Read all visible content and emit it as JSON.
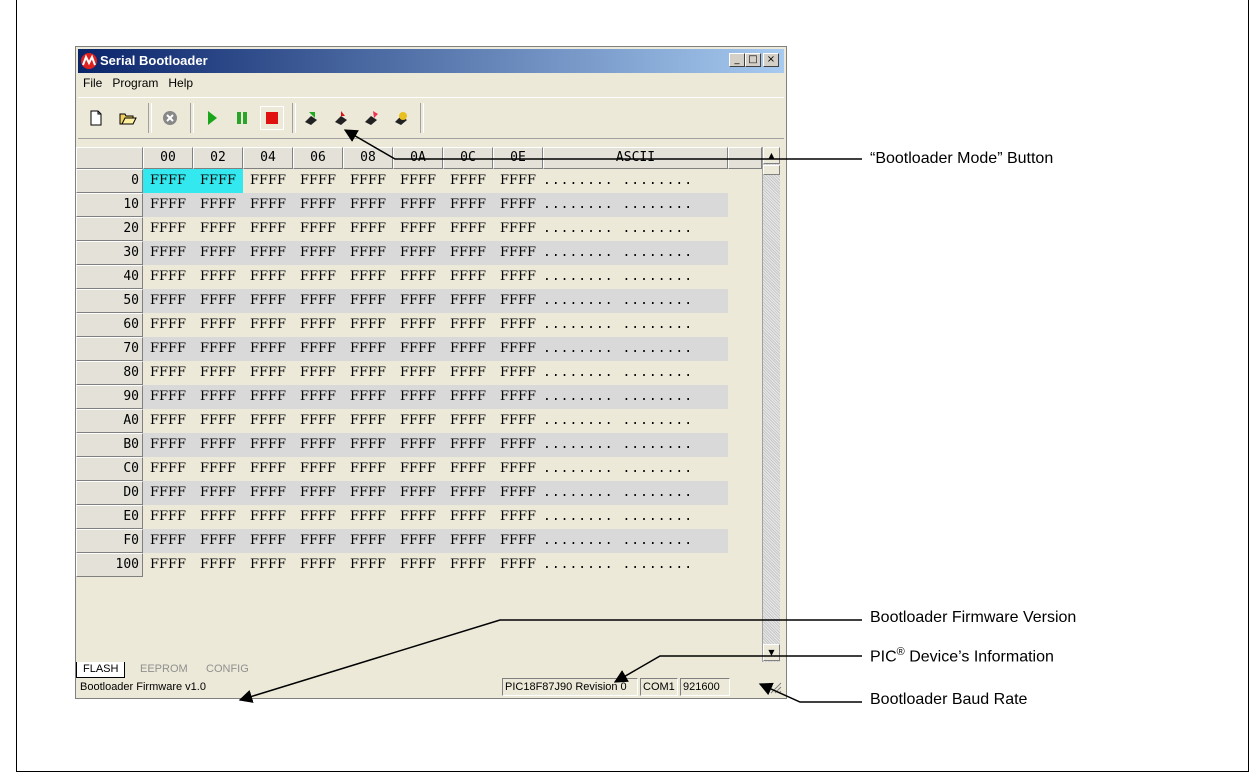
{
  "window": {
    "title": "Serial Bootloader",
    "controls": {
      "minimize": "_",
      "maximize": "□",
      "close": "×"
    }
  },
  "menu": {
    "items": [
      "File",
      "Program",
      "Help"
    ]
  },
  "toolbar": {
    "buttons": [
      "new-icon",
      "open-icon",
      "abort-icon",
      "run-icon",
      "pause-icon",
      "bootloader-mode-icon",
      "write-icon",
      "read-icon",
      "erase-icon",
      "verify-icon"
    ],
    "colors": {
      "run": "#1aa51a",
      "pause": "#2aa52a",
      "stop": "#e01010"
    }
  },
  "grid": {
    "columns": [
      "00",
      "02",
      "04",
      "06",
      "08",
      "0A",
      "0C",
      "0E",
      "ASCII"
    ],
    "rows": [
      {
        "addr": "0",
        "values": [
          "FFFF",
          "FFFF",
          "FFFF",
          "FFFF",
          "FFFF",
          "FFFF",
          "FFFF",
          "FFFF"
        ],
        "ascii": "........ ........"
      },
      {
        "addr": "10",
        "values": [
          "FFFF",
          "FFFF",
          "FFFF",
          "FFFF",
          "FFFF",
          "FFFF",
          "FFFF",
          "FFFF"
        ],
        "ascii": "........ ........"
      },
      {
        "addr": "20",
        "values": [
          "FFFF",
          "FFFF",
          "FFFF",
          "FFFF",
          "FFFF",
          "FFFF",
          "FFFF",
          "FFFF"
        ],
        "ascii": "........ ........"
      },
      {
        "addr": "30",
        "values": [
          "FFFF",
          "FFFF",
          "FFFF",
          "FFFF",
          "FFFF",
          "FFFF",
          "FFFF",
          "FFFF"
        ],
        "ascii": "........ ........"
      },
      {
        "addr": "40",
        "values": [
          "FFFF",
          "FFFF",
          "FFFF",
          "FFFF",
          "FFFF",
          "FFFF",
          "FFFF",
          "FFFF"
        ],
        "ascii": "........ ........"
      },
      {
        "addr": "50",
        "values": [
          "FFFF",
          "FFFF",
          "FFFF",
          "FFFF",
          "FFFF",
          "FFFF",
          "FFFF",
          "FFFF"
        ],
        "ascii": "........ ........"
      },
      {
        "addr": "60",
        "values": [
          "FFFF",
          "FFFF",
          "FFFF",
          "FFFF",
          "FFFF",
          "FFFF",
          "FFFF",
          "FFFF"
        ],
        "ascii": "........ ........"
      },
      {
        "addr": "70",
        "values": [
          "FFFF",
          "FFFF",
          "FFFF",
          "FFFF",
          "FFFF",
          "FFFF",
          "FFFF",
          "FFFF"
        ],
        "ascii": "........ ........"
      },
      {
        "addr": "80",
        "values": [
          "FFFF",
          "FFFF",
          "FFFF",
          "FFFF",
          "FFFF",
          "FFFF",
          "FFFF",
          "FFFF"
        ],
        "ascii": "........ ........"
      },
      {
        "addr": "90",
        "values": [
          "FFFF",
          "FFFF",
          "FFFF",
          "FFFF",
          "FFFF",
          "FFFF",
          "FFFF",
          "FFFF"
        ],
        "ascii": "........ ........"
      },
      {
        "addr": "A0",
        "values": [
          "FFFF",
          "FFFF",
          "FFFF",
          "FFFF",
          "FFFF",
          "FFFF",
          "FFFF",
          "FFFF"
        ],
        "ascii": "........ ........"
      },
      {
        "addr": "B0",
        "values": [
          "FFFF",
          "FFFF",
          "FFFF",
          "FFFF",
          "FFFF",
          "FFFF",
          "FFFF",
          "FFFF"
        ],
        "ascii": "........ ........"
      },
      {
        "addr": "C0",
        "values": [
          "FFFF",
          "FFFF",
          "FFFF",
          "FFFF",
          "FFFF",
          "FFFF",
          "FFFF",
          "FFFF"
        ],
        "ascii": "........ ........"
      },
      {
        "addr": "D0",
        "values": [
          "FFFF",
          "FFFF",
          "FFFF",
          "FFFF",
          "FFFF",
          "FFFF",
          "FFFF",
          "FFFF"
        ],
        "ascii": "........ ........"
      },
      {
        "addr": "E0",
        "values": [
          "FFFF",
          "FFFF",
          "FFFF",
          "FFFF",
          "FFFF",
          "FFFF",
          "FFFF",
          "FFFF"
        ],
        "ascii": "........ ........"
      },
      {
        "addr": "F0",
        "values": [
          "FFFF",
          "FFFF",
          "FFFF",
          "FFFF",
          "FFFF",
          "FFFF",
          "FFFF",
          "FFFF"
        ],
        "ascii": "........ ........"
      },
      {
        "addr": "100",
        "values": [
          "FFFF",
          "FFFF",
          "FFFF",
          "FFFF",
          "FFFF",
          "FFFF",
          "FFFF",
          "FFFF"
        ],
        "ascii": "........ ........"
      }
    ],
    "selected_color": "#33e8ee",
    "alt_row_color": "#d9d9d9"
  },
  "tabs": [
    "FLASH",
    "EEPROM",
    "CONFIG"
  ],
  "status": {
    "message": "Bootloader Firmware v1.0",
    "device": "PIC18F87J90 Revision 0",
    "port": "COM1",
    "baud": "921600"
  },
  "callouts": {
    "bootloader_mode": "“Bootloader Mode” Button",
    "firmware_version": "Bootloader Firmware Version",
    "device_info_prefix": "PIC",
    "device_info_sup": "®",
    "device_info_suffix": " Device’s Information",
    "baud_rate": "Bootloader Baud Rate"
  }
}
